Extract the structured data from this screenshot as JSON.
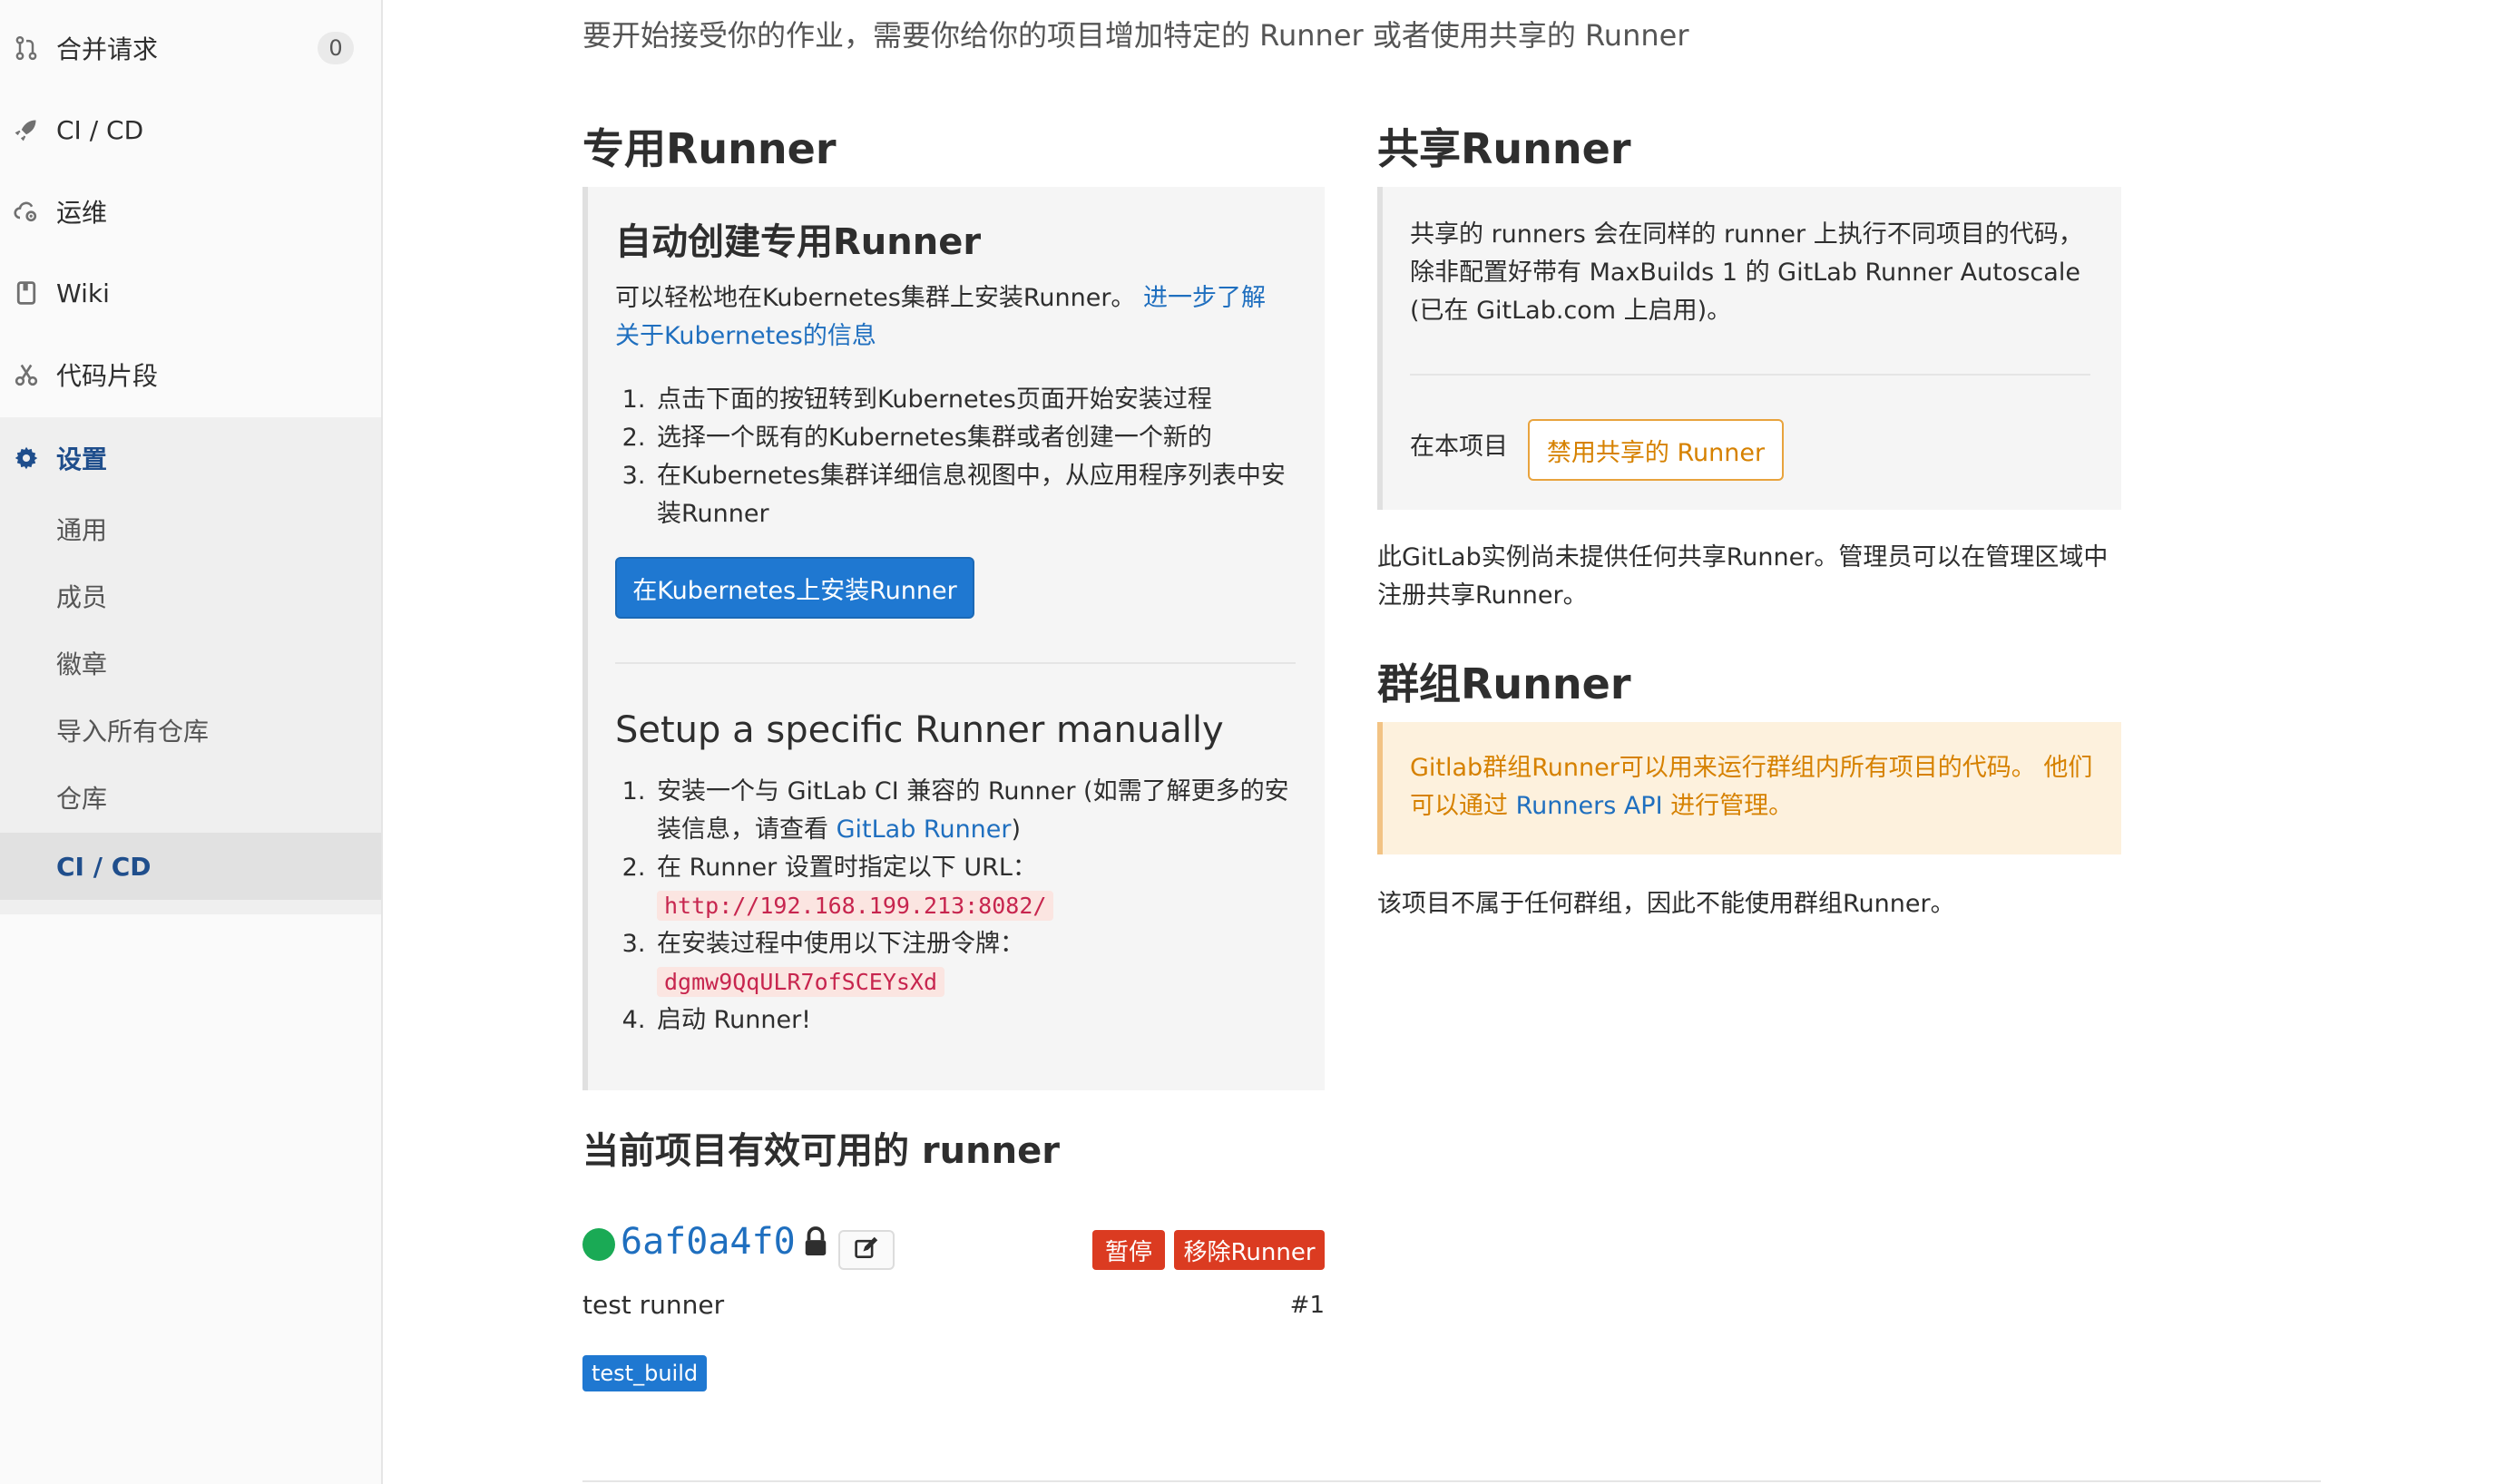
{
  "sidebar": {
    "items": [
      {
        "label": "合并请求",
        "count": "0"
      },
      {
        "label": "CI / CD"
      },
      {
        "label": "运维"
      },
      {
        "label": "Wiki"
      },
      {
        "label": "代码片段"
      },
      {
        "label": "设置"
      }
    ],
    "settings_sub": [
      {
        "label": "通用"
      },
      {
        "label": "成员"
      },
      {
        "label": "徽章"
      },
      {
        "label": "导入所有仓库"
      },
      {
        "label": "仓库"
      },
      {
        "label": "CI / CD"
      }
    ]
  },
  "main": {
    "intro": "要开始接受你的作业，需要你给你的项目增加特定的 Runner 或者使用共享的 Runner",
    "specific": {
      "heading": "专用Runner",
      "auto_title": "自动创建专用Runner",
      "auto_desc": "可以轻松地在Kubernetes集群上安装Runner。",
      "auto_link": "进一步了解关于Kubernetes的信息",
      "auto_steps": [
        "点击下面的按钮转到Kubernetes页面开始安装过程",
        "选择一个既有的Kubernetes集群或者创建一个新的",
        "在Kubernetes集群详细信息视图中，从应用程序列表中安装Runner"
      ],
      "install_button": "在Kubernetes上安装Runner",
      "manual_title": "Setup a specific Runner manually",
      "manual_step1_a": "安装一个与 GitLab CI 兼容的 Runner (如需了解更多的安装信息，请查看 ",
      "manual_step1_link": "GitLab Runner",
      "manual_step1_b": ")",
      "manual_step2": "在 Runner 设置时指定以下 URL：",
      "url": "http://192.168.199.213:8082/",
      "manual_step3": "在安装过程中使用以下注册令牌：",
      "token": "dgmw9QqULR7ofSCEYsXd",
      "manual_step4": "启动 Runner!"
    },
    "shared": {
      "heading": "共享Runner",
      "desc": "共享的 runners 会在同样的 runner 上执行不同项目的代码，除非配置好带有 MaxBuilds 1 的 GitLab Runner Autoscale (已在 GitLab.com 上启用)。",
      "this_project": "在本项目",
      "disable_button": "禁用共享的 Runner",
      "none_note": "此GitLab实例尚未提供任何共享Runner。管理员可以在管理区域中注册共享Runner。"
    },
    "group": {
      "heading": "群组Runner",
      "alert_a": "Gitlab群组Runner可以用来运行群组内所有项目的代码。 他们可以通过 ",
      "alert_link": "Runners API",
      "alert_b": " 进行管理。",
      "note": "该项目不属于任何群组，因此不能使用群组Runner。"
    },
    "active": {
      "heading": "当前项目有效可用的 runner",
      "runner_id": "6af0a4f0",
      "pause_button": "暂停",
      "remove_button": "移除Runner",
      "description": "test runner",
      "number": "#1",
      "tag": "test_build",
      "status_color": "#1aaa55"
    }
  },
  "colors": {
    "accent": "#1f78d1",
    "danger": "#db3b21",
    "warning": "#d68100"
  }
}
